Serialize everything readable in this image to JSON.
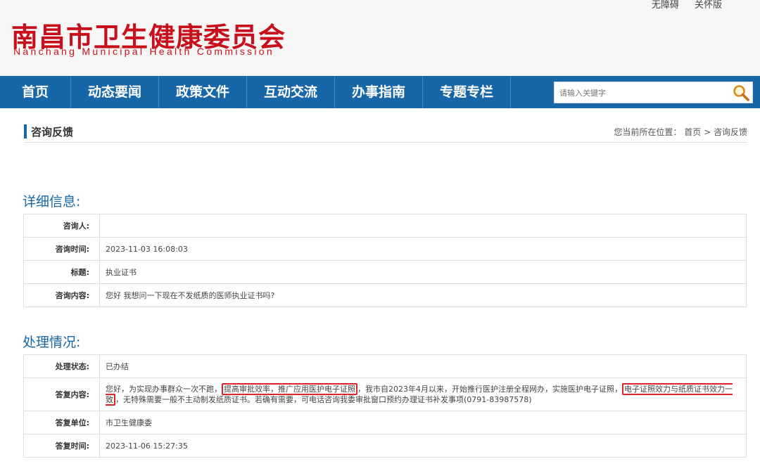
{
  "header": {
    "top_links": [
      "无障碍",
      "关怀版"
    ],
    "logo_cn": "南昌市卫生健康委员会",
    "logo_en": "Nanchang Municipal Health Commission"
  },
  "nav": {
    "items": [
      "首页",
      "动态要闻",
      "政策文件",
      "互动交流",
      "办事指南",
      "专题专栏"
    ],
    "search_placeholder": "请输入关键字"
  },
  "section": {
    "title": "咨询反馈",
    "crumb_prefix": "您当前所在位置：",
    "crumb_home": "首页",
    "crumb_sep": ">",
    "crumb_current": "咨询反馈"
  },
  "details": {
    "heading": "详细信息:",
    "rows": [
      {
        "label": "咨询人:",
        "value": ""
      },
      {
        "label": "咨询时间:",
        "value": "2023-11-03 16:08:03"
      },
      {
        "label": "标题:",
        "value": "执业证书"
      },
      {
        "label": "咨询内容:",
        "value": "您好 我想问一下现在不发纸质的医师执业证书吗?"
      }
    ]
  },
  "handling": {
    "heading": "处理情况:",
    "status_label": "处理状态:",
    "status_value": "已办结",
    "reply_label": "答复内容:",
    "reply_part1": "您好，为实现办事群众一次不跑，",
    "reply_hl1": "提高审批效率，推广应用医护电子证照",
    "reply_part2": "，我市自2023年4月以来，开始推行医护注册全程网办，实施医护电子证照，",
    "reply_hl2": "电子证照效力与纸质证书效力一致",
    "reply_part3": "，无特殊需要一般不主动制发纸质证书。若确有需要，可电话咨询我委审批窗口预约办理证书补发事项(0791-83987578)",
    "unit_label": "答复单位:",
    "unit_value": "市卫生健康委",
    "time_label": "答复时间:",
    "time_value": "2023-11-06 15:27:35"
  },
  "colors": {
    "brand_red": "#c8101c",
    "nav_blue": "#1767a8",
    "highlight_red": "#d9262c"
  }
}
